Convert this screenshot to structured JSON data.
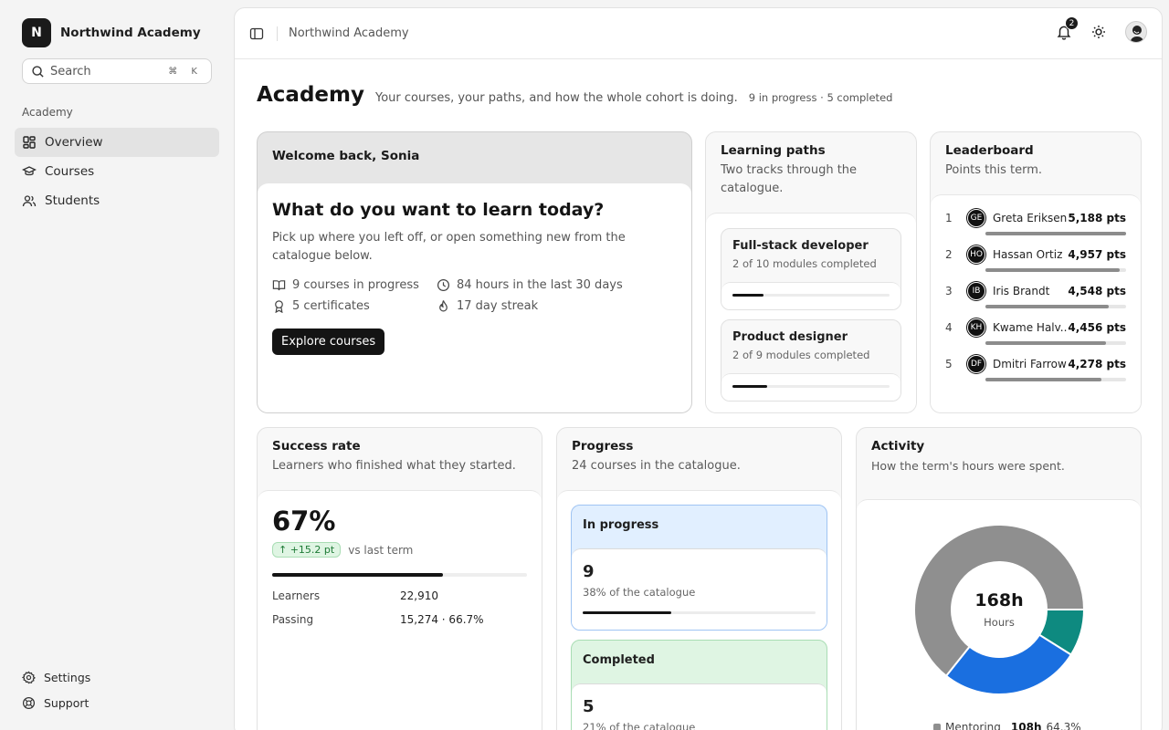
{
  "brand": {
    "logo_letter": "N",
    "name": "Northwind Academy"
  },
  "search": {
    "placeholder": "Search",
    "shortcut": "⌘ K"
  },
  "sidebar": {
    "section_label": "Academy",
    "items": [
      {
        "label": "Overview",
        "icon": "grid-icon",
        "active": true
      },
      {
        "label": "Courses",
        "icon": "graduation-cap-icon",
        "active": false
      },
      {
        "label": "Students",
        "icon": "users-icon",
        "active": false
      }
    ],
    "footer": [
      {
        "label": "Settings",
        "icon": "gear-icon"
      },
      {
        "label": "Support",
        "icon": "lifebuoy-icon"
      }
    ]
  },
  "topbar": {
    "breadcrumb": "Northwind Academy",
    "notification_count": "2"
  },
  "page": {
    "title": "Academy",
    "subtitle": "Your courses, your paths, and how the whole cohort is doing.",
    "meta": "9 in progress · 5 completed"
  },
  "welcome": {
    "greeting": "Welcome back, Sonia",
    "heading": "What do you want to learn today?",
    "body": "Pick up where you left off, or open something new from the catalogue below.",
    "stats": {
      "courses": "9 courses in progress",
      "hours": "84 hours in the last 30 days",
      "certificates": "5 certificates",
      "streak": "17 day streak"
    },
    "cta": "Explore courses"
  },
  "paths": {
    "title": "Learning paths",
    "desc": "Two tracks through the catalogue.",
    "items": [
      {
        "title": "Full-stack developer",
        "sub": "2 of 10 modules completed",
        "progress": 0.2
      },
      {
        "title": "Product designer",
        "sub": "2 of 9 modules completed",
        "progress": 0.22
      }
    ]
  },
  "leaderboard": {
    "title": "Leaderboard",
    "desc": "Points this term.",
    "rows": [
      {
        "rank": "1",
        "initials": "GE",
        "name": "Greta Eriksen",
        "points": "5,188 pts",
        "share": 1.0
      },
      {
        "rank": "2",
        "initials": "HO",
        "name": "Hassan Ortiz",
        "points": "4,957 pts",
        "share": 0.955
      },
      {
        "rank": "3",
        "initials": "IB",
        "name": "Iris Brandt",
        "points": "4,548 pts",
        "share": 0.877
      },
      {
        "rank": "4",
        "initials": "KH",
        "name": "Kwame Halv...",
        "points": "4,456 pts",
        "share": 0.859
      },
      {
        "rank": "5",
        "initials": "DF",
        "name": "Dmitri Farrow",
        "points": "4,278 pts",
        "share": 0.825
      }
    ]
  },
  "success": {
    "title": "Success rate",
    "desc": "Learners who finished what they started.",
    "value": "67%",
    "rate": 0.67,
    "delta": "+15.2 pt",
    "delta_label": "vs last term",
    "rows": [
      {
        "label": "Learners",
        "value": "22,910"
      },
      {
        "label": "Passing",
        "value": "15,274 · 66.7%"
      }
    ]
  },
  "progress": {
    "title": "Progress",
    "desc": "24 courses in the catalogue.",
    "tiles": [
      {
        "title": "In progress",
        "value": "9",
        "sub": "38% of the catalogue",
        "share": 0.38,
        "tone": "blue"
      },
      {
        "title": "Completed",
        "value": "5",
        "sub": "21% of the catalogue",
        "share": 0.21,
        "tone": "green"
      }
    ]
  },
  "activity": {
    "title": "Activity",
    "desc": "How the term's hours were spent.",
    "total": "168h",
    "total_label": "Hours",
    "segments": [
      {
        "label": "Mentoring",
        "hours": 108,
        "pct": 64.3,
        "color": "#8f8f8f"
      },
      {
        "hours": 45,
        "pct": 26.8,
        "color": "#1a6fe0"
      },
      {
        "hours": 15,
        "pct": 8.9,
        "color": "#0e8a80"
      }
    ],
    "legend": {
      "label": "Mentoring",
      "hours": "108h",
      "pct": "64.3%"
    }
  },
  "colors": {
    "accent": "#141414",
    "blue": "#1a6fe0",
    "teal": "#0e8a80",
    "gray": "#8f8f8f"
  }
}
